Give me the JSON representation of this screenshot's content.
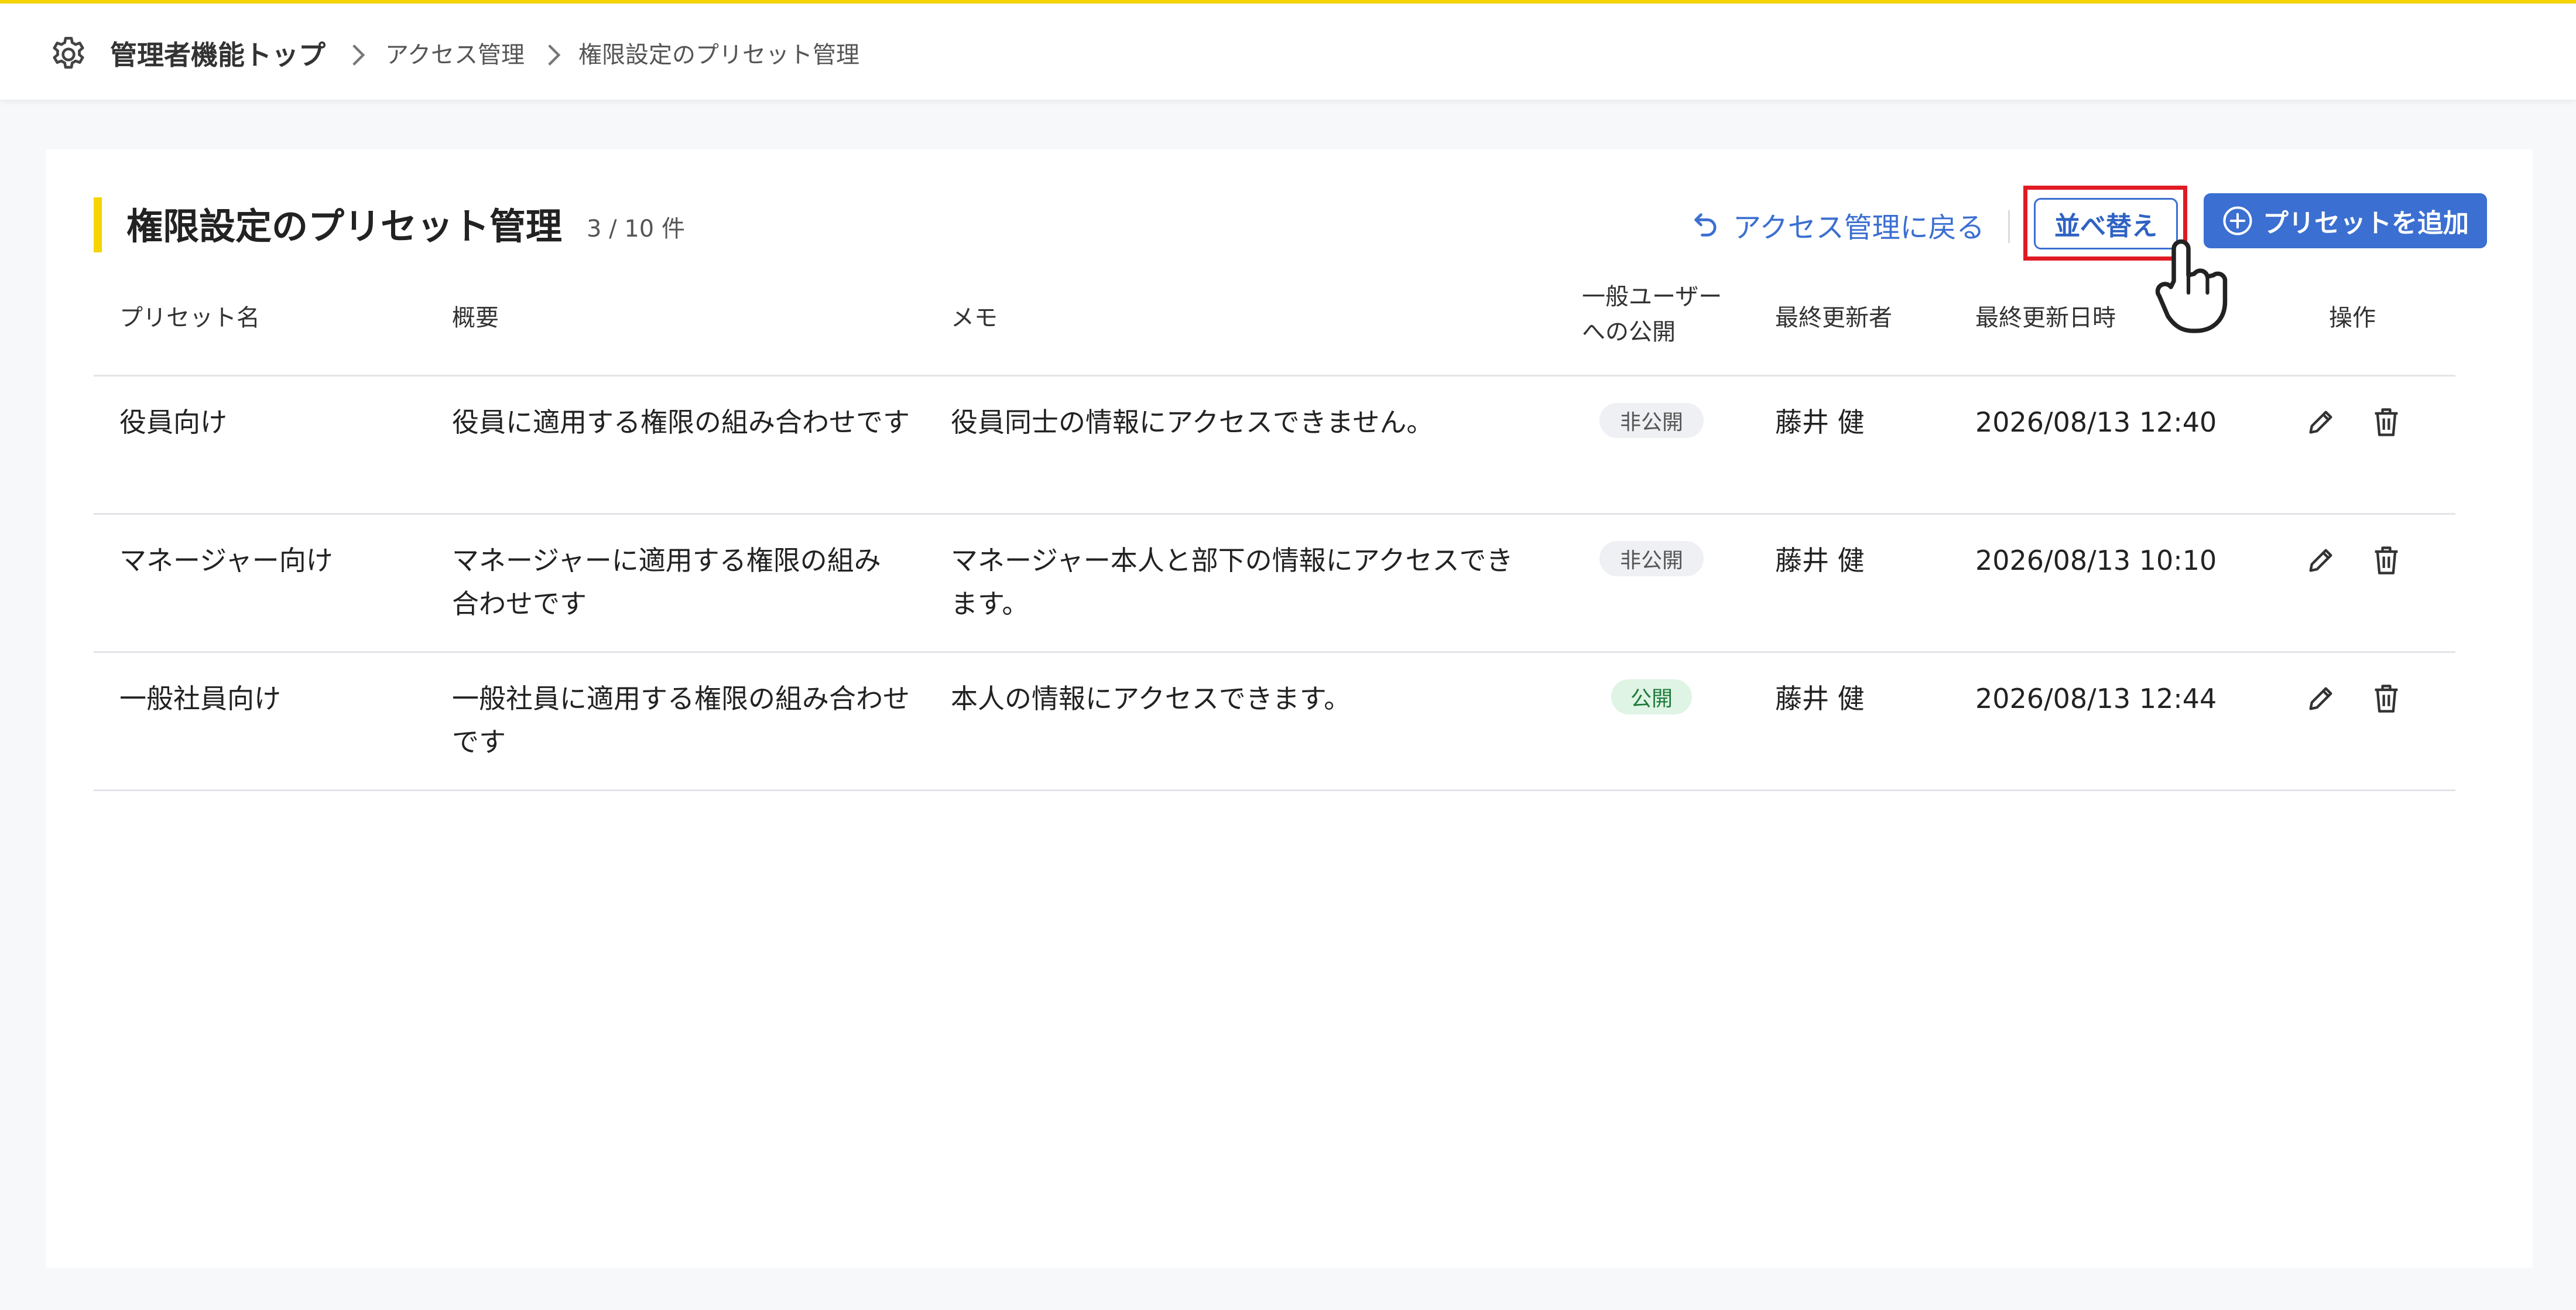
{
  "breadcrumb": {
    "top": "管理者機能トップ",
    "level1": "アクセス管理",
    "level2": "権限設定のプリセット管理"
  },
  "page": {
    "title": "権限設定のプリセット管理",
    "count": "3 / 10 件",
    "back_link": "アクセス管理に戻る",
    "sort_button": "並べ替え",
    "add_button": "プリセットを追加"
  },
  "table": {
    "headers": {
      "name": "プリセット名",
      "summary": "概要",
      "memo": "メモ",
      "visibility_line1": "一般ユーザー",
      "visibility_line2": "への公開",
      "updated_by": "最終更新者",
      "updated_at": "最終更新日時",
      "actions": "操作"
    },
    "rows": [
      {
        "name": "役員向け",
        "summary": "役員に適用する権限の組み合わせです",
        "memo": "役員同士の情報にアクセスできません。",
        "visibility": "非公開",
        "updated_by": "藤井 健",
        "updated_at": "2026/08/13 12:40"
      },
      {
        "name": "マネージャー向け",
        "summary": "マネージャーに適用する権限の組み合わせです",
        "memo": "マネージャー本人と部下の情報にアクセスできます。",
        "visibility": "非公開",
        "updated_by": "藤井 健",
        "updated_at": "2026/08/13 10:10"
      },
      {
        "name": "一般社員向け",
        "summary": "一般社員に適用する権限の組み合わせです",
        "memo": "本人の情報にアクセスできます。",
        "visibility": "公開",
        "updated_by": "藤井 健",
        "updated_at": "2026/08/13 12:44"
      }
    ]
  },
  "icons": {
    "settings": "gear-icon",
    "separator": "chevron-right-icon",
    "back": "undo-arrow-icon",
    "add": "plus-circle-icon",
    "edit": "pencil-icon",
    "delete": "trash-icon",
    "cursor": "hand-pointer-icon"
  },
  "colors": {
    "accent_yellow": "#f5d400",
    "primary_blue": "#3b6fd1",
    "highlight_red": "#e01b24",
    "public_badge_bg": "#dff4e4",
    "private_badge_bg": "#eef0f3"
  }
}
